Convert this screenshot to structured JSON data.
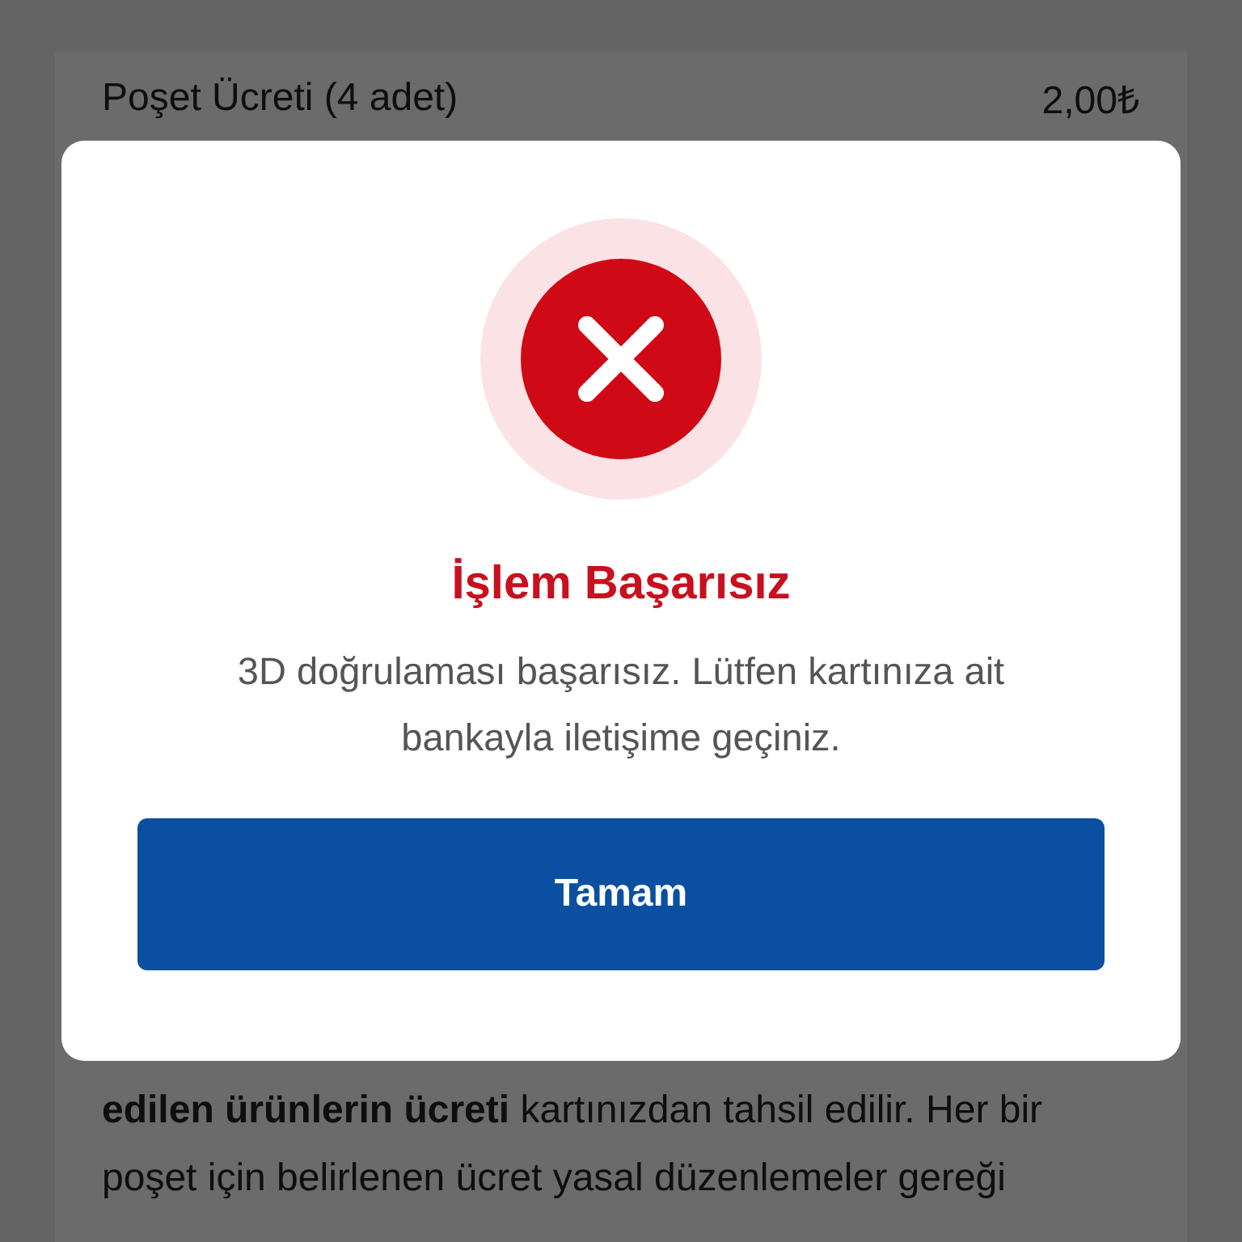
{
  "summary": {
    "rows": [
      {
        "label": "Poşet Ücreti (4 adet)",
        "value": "2,00₺"
      }
    ],
    "note": "**edilen ürünlerin ücreti** kartınızdan tahsil edilir. Her bir poşet için belirlenen ücret yasal düzenlemeler gereği"
  },
  "dialog": {
    "title": "İşlem Başarısız",
    "message": "3D doğrulaması başarısız. Lütfen kartınıza ait bankayla iletişime geçiniz.",
    "button": "Tamam"
  }
}
